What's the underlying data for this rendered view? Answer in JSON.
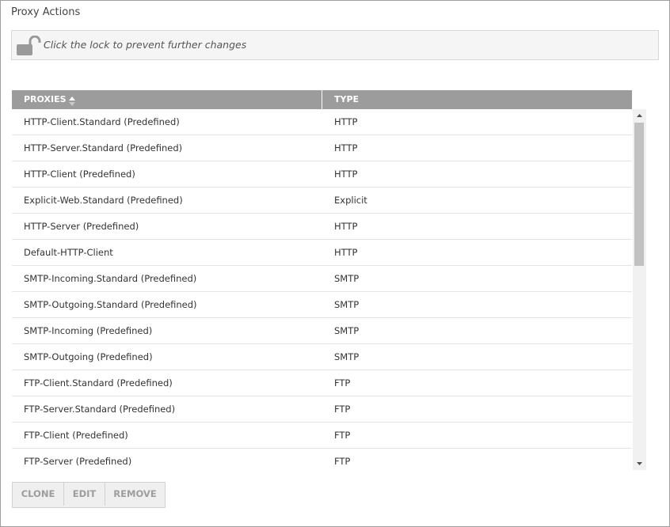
{
  "page": {
    "title": "Proxy Actions"
  },
  "lock": {
    "icon": "unlocked-padlock-icon",
    "message": "Click the lock to prevent further changes"
  },
  "table": {
    "columns": [
      {
        "label": "PROXIES",
        "sortable": true,
        "sort": "neutral"
      },
      {
        "label": "TYPE",
        "sortable": false
      }
    ],
    "rows": [
      {
        "name": "HTTP-Client.Standard (Predefined)",
        "type": "HTTP"
      },
      {
        "name": "HTTP-Server.Standard (Predefined)",
        "type": "HTTP"
      },
      {
        "name": "HTTP-Client (Predefined)",
        "type": "HTTP"
      },
      {
        "name": "Explicit-Web.Standard (Predefined)",
        "type": "Explicit"
      },
      {
        "name": "HTTP-Server (Predefined)",
        "type": "HTTP"
      },
      {
        "name": "Default-HTTP-Client",
        "type": "HTTP"
      },
      {
        "name": "SMTP-Incoming.Standard (Predefined)",
        "type": "SMTP"
      },
      {
        "name": "SMTP-Outgoing.Standard (Predefined)",
        "type": "SMTP"
      },
      {
        "name": "SMTP-Incoming (Predefined)",
        "type": "SMTP"
      },
      {
        "name": "SMTP-Outgoing (Predefined)",
        "type": "SMTP"
      },
      {
        "name": "FTP-Client.Standard (Predefined)",
        "type": "FTP"
      },
      {
        "name": "FTP-Server.Standard (Predefined)",
        "type": "FTP"
      },
      {
        "name": "FTP-Client (Predefined)",
        "type": "FTP"
      },
      {
        "name": "FTP-Server (Predefined)",
        "type": "FTP"
      }
    ]
  },
  "actions": {
    "clone_label": "CLONE",
    "edit_label": "EDIT",
    "remove_label": "REMOVE",
    "enabled": false
  },
  "colors": {
    "header_bg": "#9c9c9c",
    "header_text": "#ffffff",
    "row_divider": "#e4e4e4",
    "lock_icon": "#9a9a9a",
    "button_disabled_text": "#9d9d9d"
  }
}
